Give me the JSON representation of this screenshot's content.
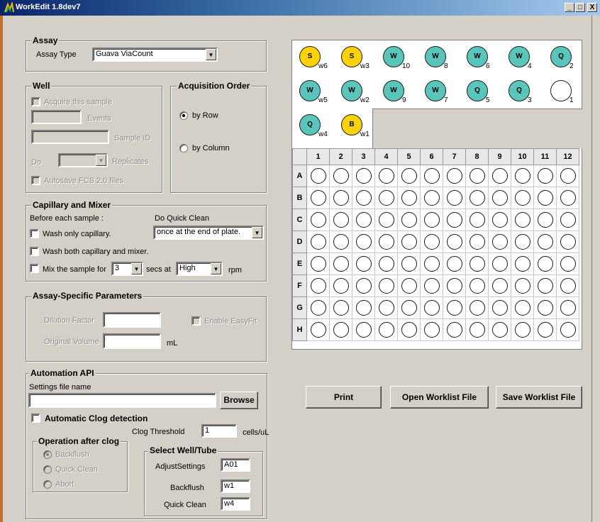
{
  "window": {
    "title": "WorkEdit 1.8dev7",
    "controls": {
      "minimize": "_",
      "maximize": "□",
      "close": "X"
    }
  },
  "assay": {
    "group_label": "Assay",
    "type_label": "Assay Type",
    "type_value": "Guava ViaCount"
  },
  "well": {
    "group_label": "Well",
    "acquire_label": "Acquire this sample",
    "events_label": "Events",
    "sample_id_label": "Sample ID",
    "do_label": "Do",
    "replicates_label": "Replicates",
    "autosave_label": "Autosave FCS 2.0 files"
  },
  "acquisition": {
    "group_label": "Acquisition Order",
    "by_row_label": "by Row",
    "by_column_label": "by Column",
    "selected": "by Row"
  },
  "capillary": {
    "group_label": "Capillary and Mixer",
    "before_label": "Before each sample :",
    "quick_clean_label": "Do Quick Clean",
    "quick_clean_value": "once at the end of plate.",
    "wash_capillary_label": "Wash only capillary.",
    "wash_both_label": "Wash both capillary and mixer.",
    "mix_label": "Mix the sample for",
    "mix_secs_value": "3",
    "secs_at_label": "secs at",
    "speed_value": "High",
    "rpm_label": "rpm"
  },
  "assay_params": {
    "group_label": "Assay-Specific Parameters",
    "dilution_label": "Dilution Factor",
    "enable_easyfit_label": "Enable EasyFit",
    "original_volume_label": "Original Volume",
    "ml_label": "mL"
  },
  "automation": {
    "group_label": "Automation API",
    "settings_file_label": "Settings file name",
    "browse_label": "Browse",
    "clog_detection_label": "Automatic Clog detection",
    "clog_threshold_label": "Clog Threshold",
    "clog_threshold_value": "1",
    "cells_unit_label": "cells/uL",
    "operation_group_label": "Operation after clog",
    "backflush_label": "Backflush",
    "quick_clean_label": "Quick Clean",
    "abort_label": "Abort",
    "select_group_label": "Select Well/Tube",
    "adjust_settings_label": "AdjustSettings",
    "adjust_settings_value": "A01",
    "backflush_tube_label": "Backflush",
    "backflush_tube_value": "w1",
    "quick_clean_tube_label": "Quick Clean",
    "quick_clean_tube_value": "w4"
  },
  "tubes": [
    {
      "letter": "S",
      "num": "w6",
      "kind": "S"
    },
    {
      "letter": "S",
      "num": "w3",
      "kind": "S"
    },
    {
      "letter": "W",
      "num": "10",
      "kind": "W"
    },
    {
      "letter": "W",
      "num": "8",
      "kind": "W"
    },
    {
      "letter": "W",
      "num": "6",
      "kind": "W"
    },
    {
      "letter": "W",
      "num": "4",
      "kind": "W"
    },
    {
      "letter": "Q",
      "num": "2",
      "kind": "Q"
    },
    {
      "letter": "W",
      "num": "w5",
      "kind": "W"
    },
    {
      "letter": "W",
      "num": "w2",
      "kind": "W"
    },
    {
      "letter": "W",
      "num": "9",
      "kind": "W"
    },
    {
      "letter": "W",
      "num": "7",
      "kind": "W"
    },
    {
      "letter": "Q",
      "num": "5",
      "kind": "Q"
    },
    {
      "letter": "Q",
      "num": "3",
      "kind": "Q"
    },
    {
      "letter": "",
      "num": "1",
      "kind": "empty"
    },
    {
      "letter": "Q",
      "num": "w4",
      "kind": "Q"
    },
    {
      "letter": "B",
      "num": "w1",
      "kind": "B"
    }
  ],
  "plate": {
    "columns": [
      "1",
      "2",
      "3",
      "4",
      "5",
      "6",
      "7",
      "8",
      "9",
      "10",
      "11",
      "12"
    ],
    "rows": [
      "A",
      "B",
      "C",
      "D",
      "E",
      "F",
      "G",
      "H"
    ]
  },
  "buttons": {
    "print": "Print",
    "open_worklist": "Open Worklist File",
    "save_worklist": "Save Worklist File"
  },
  "colors": {
    "sample_tube": "#ffd200",
    "wash_tube": "#59c5bb",
    "title_bar": "#0a246a"
  }
}
